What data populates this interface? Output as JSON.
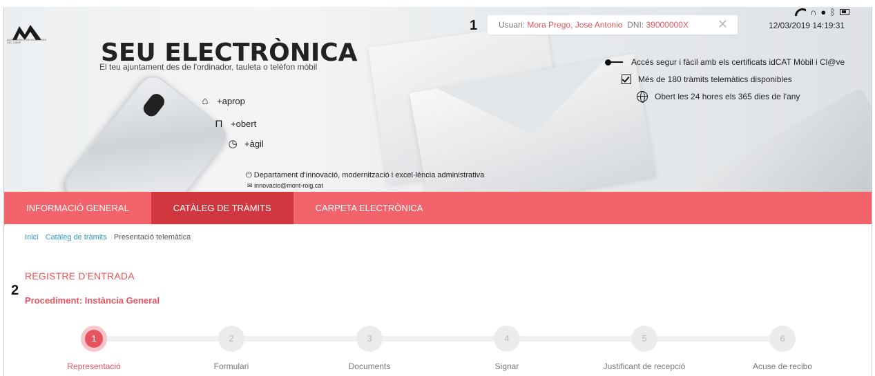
{
  "banner": {
    "logo_text": "AJUNTAMENT DE MONT-ROIG DEL CAMP",
    "title": "SEU ELECTRÒNICA",
    "subtitle": "El teu ajuntament des de l'ordinador, tauleta o telèfon mòbil",
    "features_left": [
      {
        "icon": "home-icon",
        "glyph": "⌂",
        "text": "+aprop"
      },
      {
        "icon": "unlock-icon",
        "glyph": "🔓",
        "text": "+obert"
      },
      {
        "icon": "clock-icon",
        "glyph": "◷",
        "text": "+àgil"
      }
    ],
    "features_right": [
      {
        "icon": "key-icon",
        "text": "Accés segur i fàcil amb els certificats idCAT Mòbil i Cl@ve"
      },
      {
        "icon": "checkbox-icon",
        "text": "Més de 180 tràmits telemàtics disponibles"
      },
      {
        "icon": "globe-icon",
        "text": "Obert les 24 hores els 365 dies de l'any"
      }
    ],
    "department": "Departament d'innovació, modernització i excel·lència administrativa",
    "email": "innovacio@mont-roig.cat"
  },
  "session": {
    "user_label": "Usuari:",
    "user_name": "Mora Prego, Jose Antonio",
    "dni_label": "DNI:",
    "dni_value": "39000000X",
    "close": "✕",
    "datetime": "12/03/2019 14:19:31"
  },
  "markers": {
    "one": "1",
    "two": "2"
  },
  "nav": {
    "items": [
      {
        "label": "INFORMACIÓ GENERAL",
        "active": false
      },
      {
        "label": "CATÀLEG DE TRÀMITS",
        "active": true
      },
      {
        "label": "CARPETA ELECTRÒNICA",
        "active": false
      }
    ]
  },
  "breadcrumb": {
    "home": "Inici",
    "catalog": "Catàleg de tràmits",
    "current": "Presentació telemàtica"
  },
  "main": {
    "title": "REGISTRE D'ENTRADA",
    "procedure": "Procediment: Instància General"
  },
  "stepper": {
    "steps": [
      {
        "num": "1",
        "label": "Representació",
        "active": true
      },
      {
        "num": "2",
        "label": "Formulari",
        "active": false
      },
      {
        "num": "3",
        "label": "Documents",
        "active": false
      },
      {
        "num": "4",
        "label": "Signar",
        "active": false
      },
      {
        "num": "5",
        "label": "Justificant de recepció",
        "active": false
      },
      {
        "num": "6",
        "label": "Acuse de recibo",
        "active": false
      }
    ]
  },
  "colors": {
    "brand_red": "#f2636c",
    "active_red": "#d1373f",
    "accent": "#e8535d",
    "link": "#2e9ad0"
  }
}
